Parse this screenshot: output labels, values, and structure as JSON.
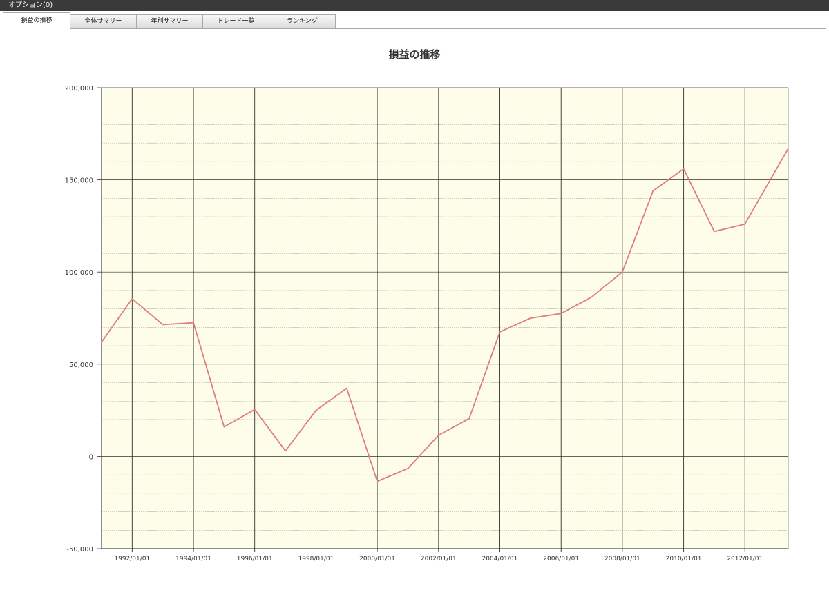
{
  "window": {
    "title": "オプション(0)"
  },
  "tabs": [
    {
      "label": "損益の推移",
      "active": true
    },
    {
      "label": "全体サマリー",
      "active": false
    },
    {
      "label": "年別サマリー",
      "active": false
    },
    {
      "label": "トレード一覧",
      "active": false
    },
    {
      "label": "ランキング",
      "active": false
    }
  ],
  "colors": {
    "plot_background": "#fdfde9",
    "series_line": "#e07b7b",
    "major_grid": "#333333",
    "minor_grid": "#b5b5b5"
  },
  "chart_data": {
    "type": "line",
    "title": "損益の推移",
    "xlabel": "",
    "ylabel": "",
    "ylim": [
      -50000,
      200000
    ],
    "xlim": [
      "1991/01/01",
      "2013/06/01"
    ],
    "y_ticks": [
      "200,000",
      "150,000",
      "100,000",
      "50,000",
      "0",
      "-50,000"
    ],
    "x_ticks": [
      "1992/01/01",
      "1994/01/01",
      "1996/01/01",
      "1998/01/01",
      "2000/01/01",
      "2002/01/01",
      "2004/01/01",
      "2006/01/01",
      "2008/01/01",
      "2010/01/01",
      "2012/01/01"
    ],
    "grid": true,
    "legend": "none",
    "series": [
      {
        "x": [
          "1991/01/01",
          "1992/01/01",
          "1993/01/01",
          "1994/01/01",
          "1995/01/01",
          "1996/01/01",
          "1997/01/01",
          "1998/01/01",
          "1999/01/01",
          "2000/01/01",
          "2001/01/01",
          "2002/01/01",
          "2003/01/01",
          "2004/01/01",
          "2005/01/01",
          "2006/01/01",
          "2007/01/01",
          "2008/01/01",
          "2009/01/01",
          "2010/01/01",
          "2011/01/01",
          "2012/01/01",
          "2013/06/01"
        ],
        "values": [
          62000,
          85500,
          71500,
          72500,
          16000,
          25500,
          3000,
          25000,
          37000,
          -13500,
          -6500,
          11500,
          20500,
          67500,
          75000,
          77500,
          86500,
          100000,
          144000,
          156000,
          122000,
          126000,
          167000
        ]
      }
    ]
  }
}
